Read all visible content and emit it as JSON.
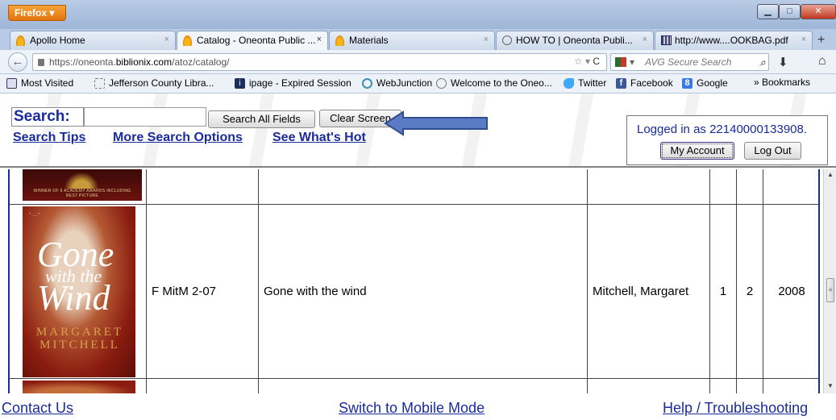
{
  "browser": {
    "menu_label": "Firefox",
    "tabs": [
      {
        "label": "Apollo Home"
      },
      {
        "label": "Catalog - Oneonta Public ..."
      },
      {
        "label": "Materials"
      },
      {
        "label": "HOW TO | Oneonta Publi..."
      },
      {
        "label": "http://www....OOKBAG.pdf"
      }
    ],
    "tab_close": "×",
    "new_tab": "+",
    "url_prefix": "https://oneonta.",
    "url_domain": "biblionix.com",
    "url_suffix": "/atoz/catalog/",
    "search_placeholder": "AVG Secure Search",
    "bookmarks": [
      {
        "label": "Most Visited"
      },
      {
        "label": "Jefferson County Libra..."
      },
      {
        "label": "ipage - Expired Session"
      },
      {
        "label": "WebJunction"
      },
      {
        "label": "Welcome to the Oneo..."
      },
      {
        "label": "Twitter"
      },
      {
        "label": "Facebook"
      },
      {
        "label": "Google"
      }
    ],
    "bookmarks_more": "» Bookmarks"
  },
  "header": {
    "search_label": "Search:",
    "search_value": "",
    "search_all_button": "Search All Fields",
    "clear_button": "Clear Screen",
    "links": {
      "search_tips": "Search Tips",
      "more_options": "More Search Options",
      "whats_hot": "See What's Hot"
    },
    "login": {
      "status": "Logged in as 22140000133908.",
      "my_account": "My Account",
      "log_out": "Log Out"
    }
  },
  "results": {
    "row": {
      "call_number": "F MitM 2-07",
      "title": "Gone with the wind",
      "author": "Mitchell, Margaret",
      "col_a": "1",
      "col_b": "2",
      "year": "2008"
    },
    "cover": {
      "title_line1": "Gone",
      "title_line2": "with the",
      "title_line3": "Wind",
      "author_line1": "MARGARET",
      "author_line2": "MITCHELL",
      "top_award": "WINNER OF 8 ACADEMY AWARDS INCLUDING BEST PICTURE"
    }
  },
  "footer": {
    "contact": "Contact Us",
    "mobile": "Switch to Mobile Mode",
    "help": "Help / Troubleshooting"
  }
}
